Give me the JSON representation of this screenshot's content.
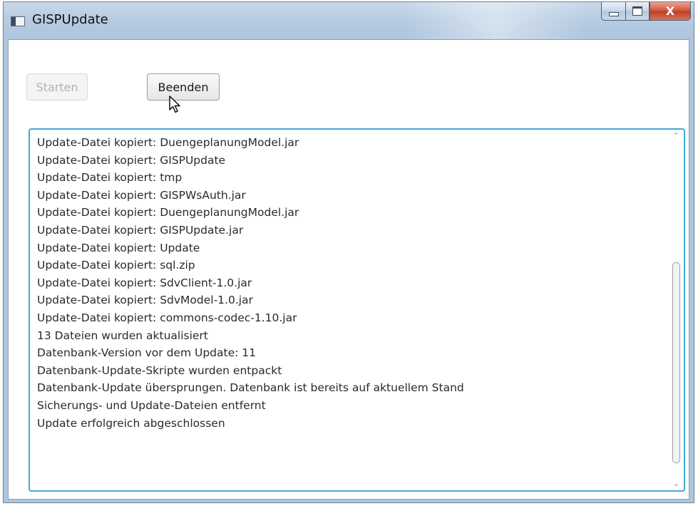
{
  "window": {
    "title": "GISPUpdate",
    "controls": {
      "minimize": "",
      "maximize": "",
      "close": "X"
    }
  },
  "toolbar": {
    "start_label": "Starten",
    "stop_label": "Beenden"
  },
  "log": {
    "lines": [
      "Update-Datei kopiert: DuengeplanungModel.jar",
      "Update-Datei kopiert: GISPUpdate",
      "Update-Datei kopiert: tmp",
      "Update-Datei kopiert: GISPWsAuth.jar",
      "Update-Datei kopiert: DuengeplanungModel.jar",
      "Update-Datei kopiert: GISPUpdate.jar",
      "Update-Datei kopiert: Update",
      "Update-Datei kopiert: sql.zip",
      "Update-Datei kopiert: SdvClient-1.0.jar",
      "Update-Datei kopiert: SdvModel-1.0.jar",
      "Update-Datei kopiert: commons-codec-1.10.jar",
      "13 Dateien wurden aktualisiert",
      "Datenbank-Version vor dem Update: 11",
      "Datenbank-Update-Skripte wurden entpackt",
      "Datenbank-Update übersprungen. Datenbank ist bereits auf aktuellem Stand",
      "Sicherungs- und Update-Dateien entfernt",
      "Update erfolgreich abgeschlossen"
    ]
  },
  "colors": {
    "focus_border": "#3fa9d6",
    "disabled_text": "#b3b3b3",
    "close_button": "#c13a22"
  },
  "icons": {
    "app": "window-app-icon",
    "cursor": "arrow-cursor-icon"
  }
}
